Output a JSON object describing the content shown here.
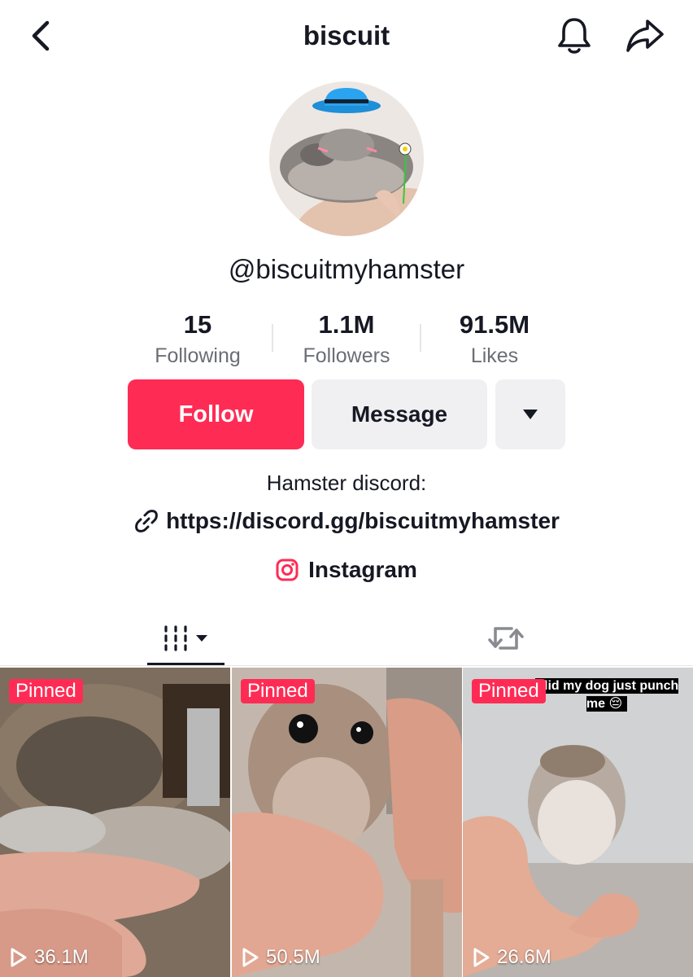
{
  "header": {
    "title": "biscuit",
    "back_icon": "chevron-left-icon",
    "bell_icon": "bell-icon",
    "share_icon": "share-arrow-icon"
  },
  "profile": {
    "handle": "@biscuitmyhamster",
    "stats": [
      {
        "value": "15",
        "label": "Following"
      },
      {
        "value": "1.1M",
        "label": "Followers"
      },
      {
        "value": "91.5M",
        "label": "Likes"
      }
    ],
    "follow_label": "Follow",
    "message_label": "Message",
    "bio": "Hamster discord:",
    "link": "https://discord.gg/biscuitmyhamster",
    "instagram": "Instagram"
  },
  "colors": {
    "accent": "#fe2c55",
    "text": "#161823",
    "muted": "#6b6d76",
    "button_gray": "#f0f0f2"
  },
  "videos": [
    {
      "pinned": "Pinned",
      "views": "36.1M"
    },
    {
      "pinned": "Pinned",
      "views": "50.5M"
    },
    {
      "pinned": "Pinned",
      "views": "26.6M",
      "caption": "did my dog just punch me 😔"
    }
  ]
}
